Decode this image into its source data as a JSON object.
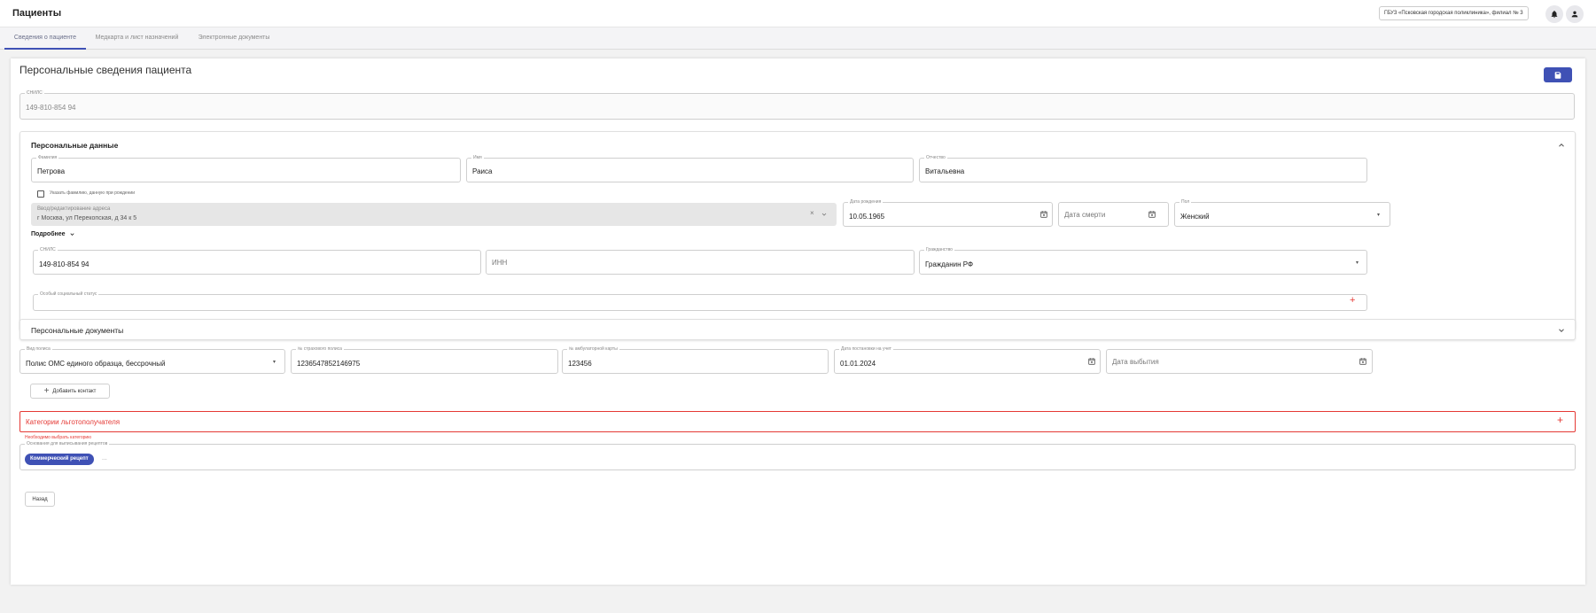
{
  "header": {
    "title": "Пациенты",
    "org": "ГБУЗ «Псковская городская поликлиника», филиал № 3"
  },
  "tabs": [
    {
      "label": "Сведения о пациенте"
    },
    {
      "label": "Медкарта и лист назначений"
    },
    {
      "label": "Электронные документы"
    }
  ],
  "page": {
    "title": "Персональные сведения пациента"
  },
  "snils_top": {
    "label": "СНИЛС",
    "value": "149-810-854 94"
  },
  "personal": {
    "title": "Персональные данные",
    "surname": {
      "label": "Фамилия",
      "value": "Петрова"
    },
    "name": {
      "label": "Имя",
      "value": "Раиса"
    },
    "patronymic": {
      "label": "Отчество",
      "value": "Витальевна"
    },
    "birth_surname_checkbox": "Указать фамилию, данную при рождении",
    "address": {
      "label": "Ввод/редактирование адреса",
      "value": "г Москва, ул Перекопская, д 34 к 5"
    },
    "birth_date": {
      "label": "Дата рождения",
      "value": "10.05.1965"
    },
    "death_date": {
      "placeholder": "Дата смерти"
    },
    "gender": {
      "label": "Пол",
      "value": "Женский"
    },
    "more": "Подробнее",
    "snils": {
      "label": "СНИЛС",
      "value": "149-810-854 94"
    },
    "inn": {
      "placeholder": "ИНН"
    },
    "citizenship": {
      "label": "Гражданство",
      "value": "Гражданин РФ"
    },
    "social_status": {
      "label": "Особый социальный статус"
    }
  },
  "documents": {
    "title": "Персональные документы"
  },
  "policy": {
    "type": {
      "label": "Вид полиса",
      "value": "Полис ОМС единого образца, бессрочный"
    },
    "number": {
      "label": "№ страхового полиса",
      "value": "1236547852146975"
    },
    "card": {
      "label": "№ амбулаторной карты",
      "value": "123456"
    },
    "reg_date": {
      "label": "Дата постановки на учет",
      "value": "01.01.2024"
    },
    "leave_date": {
      "placeholder": "Дата выбытия"
    }
  },
  "add_contact": "Добавить контакт",
  "benefits": {
    "title": "Категории льготополучателя",
    "error": "Необходимо выбрать категорию"
  },
  "prescription": {
    "label": "Основания для выписывания рецептов",
    "chip": "Коммерческий рецепт",
    "more": "..."
  },
  "back": "Назад",
  "colors": {
    "accent": "#3f51b5",
    "error": "#e53935"
  }
}
